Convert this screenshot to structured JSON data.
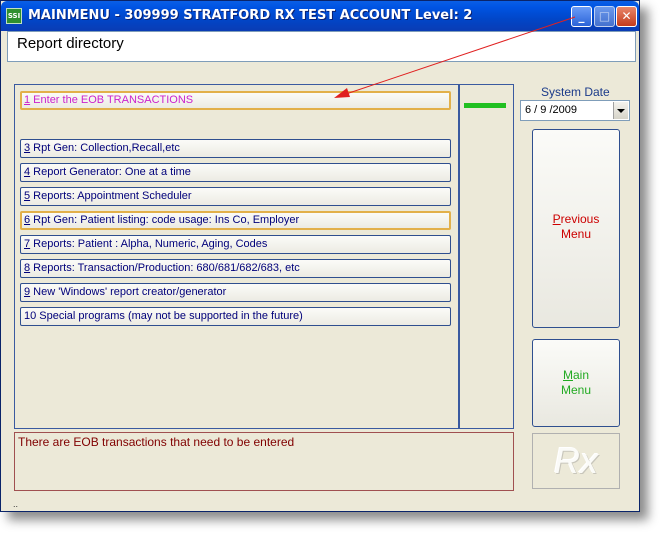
{
  "window": {
    "icon_text": "SSI",
    "title": "MAINMENU - 309999 STRATFORD RX TEST ACCOUNT Level: 2",
    "minimize_glyph": "_",
    "maximize_glyph": "□",
    "close_glyph": "✕"
  },
  "header": {
    "title": "Report directory"
  },
  "menu": {
    "items": [
      {
        "key": "1",
        "rest": " Enter the EOB TRANSACTIONS"
      },
      {
        "key": "3",
        "rest": " Rpt Gen: Collection,Recall,etc"
      },
      {
        "key": "4",
        "rest": " Report Generator: One at a time"
      },
      {
        "key": "5",
        "rest": " Reports: Appointment Scheduler"
      },
      {
        "key": "6",
        "rest": " Rpt Gen: Patient  listing: code usage: Ins Co, Employer"
      },
      {
        "key": "7",
        "rest": " Reports: Patient : Alpha, Numeric, Aging, Codes"
      },
      {
        "key": "8",
        "rest": " Reports: Transaction/Production: 680/681/682/683, etc"
      },
      {
        "key": "9",
        "rest": " New 'Windows' report creator/generator"
      },
      {
        "key": "",
        "rest": "10 Special programs (may not be supported in the future)"
      }
    ]
  },
  "message": "There are EOB transactions that need to be entered",
  "system_date": {
    "label": "System Date",
    "value": "6 / 9 /2009"
  },
  "buttons": {
    "previous": {
      "accel": "P",
      "line1_rest": "revious",
      "line2": "Menu"
    },
    "main": {
      "accel": "M",
      "line1_rest": "ain",
      "line2": "Menu"
    }
  },
  "logo_text": "Rx",
  "status_dots": "..",
  "colors": {
    "title_bar": "#0054e3",
    "first_item_text": "#cc22cc",
    "item_text": "#00007a",
    "previous_button_text": "#cc0000",
    "main_button_text": "#22aa22",
    "message_text": "#800000",
    "annotation_arrow": "#e02020"
  },
  "icons": {
    "app": "ssi-app-icon",
    "minimize": "minimize-icon",
    "maximize": "maximize-icon",
    "close": "close-icon",
    "dropdown": "chevron-down-icon",
    "annotation": "arrow-icon"
  }
}
